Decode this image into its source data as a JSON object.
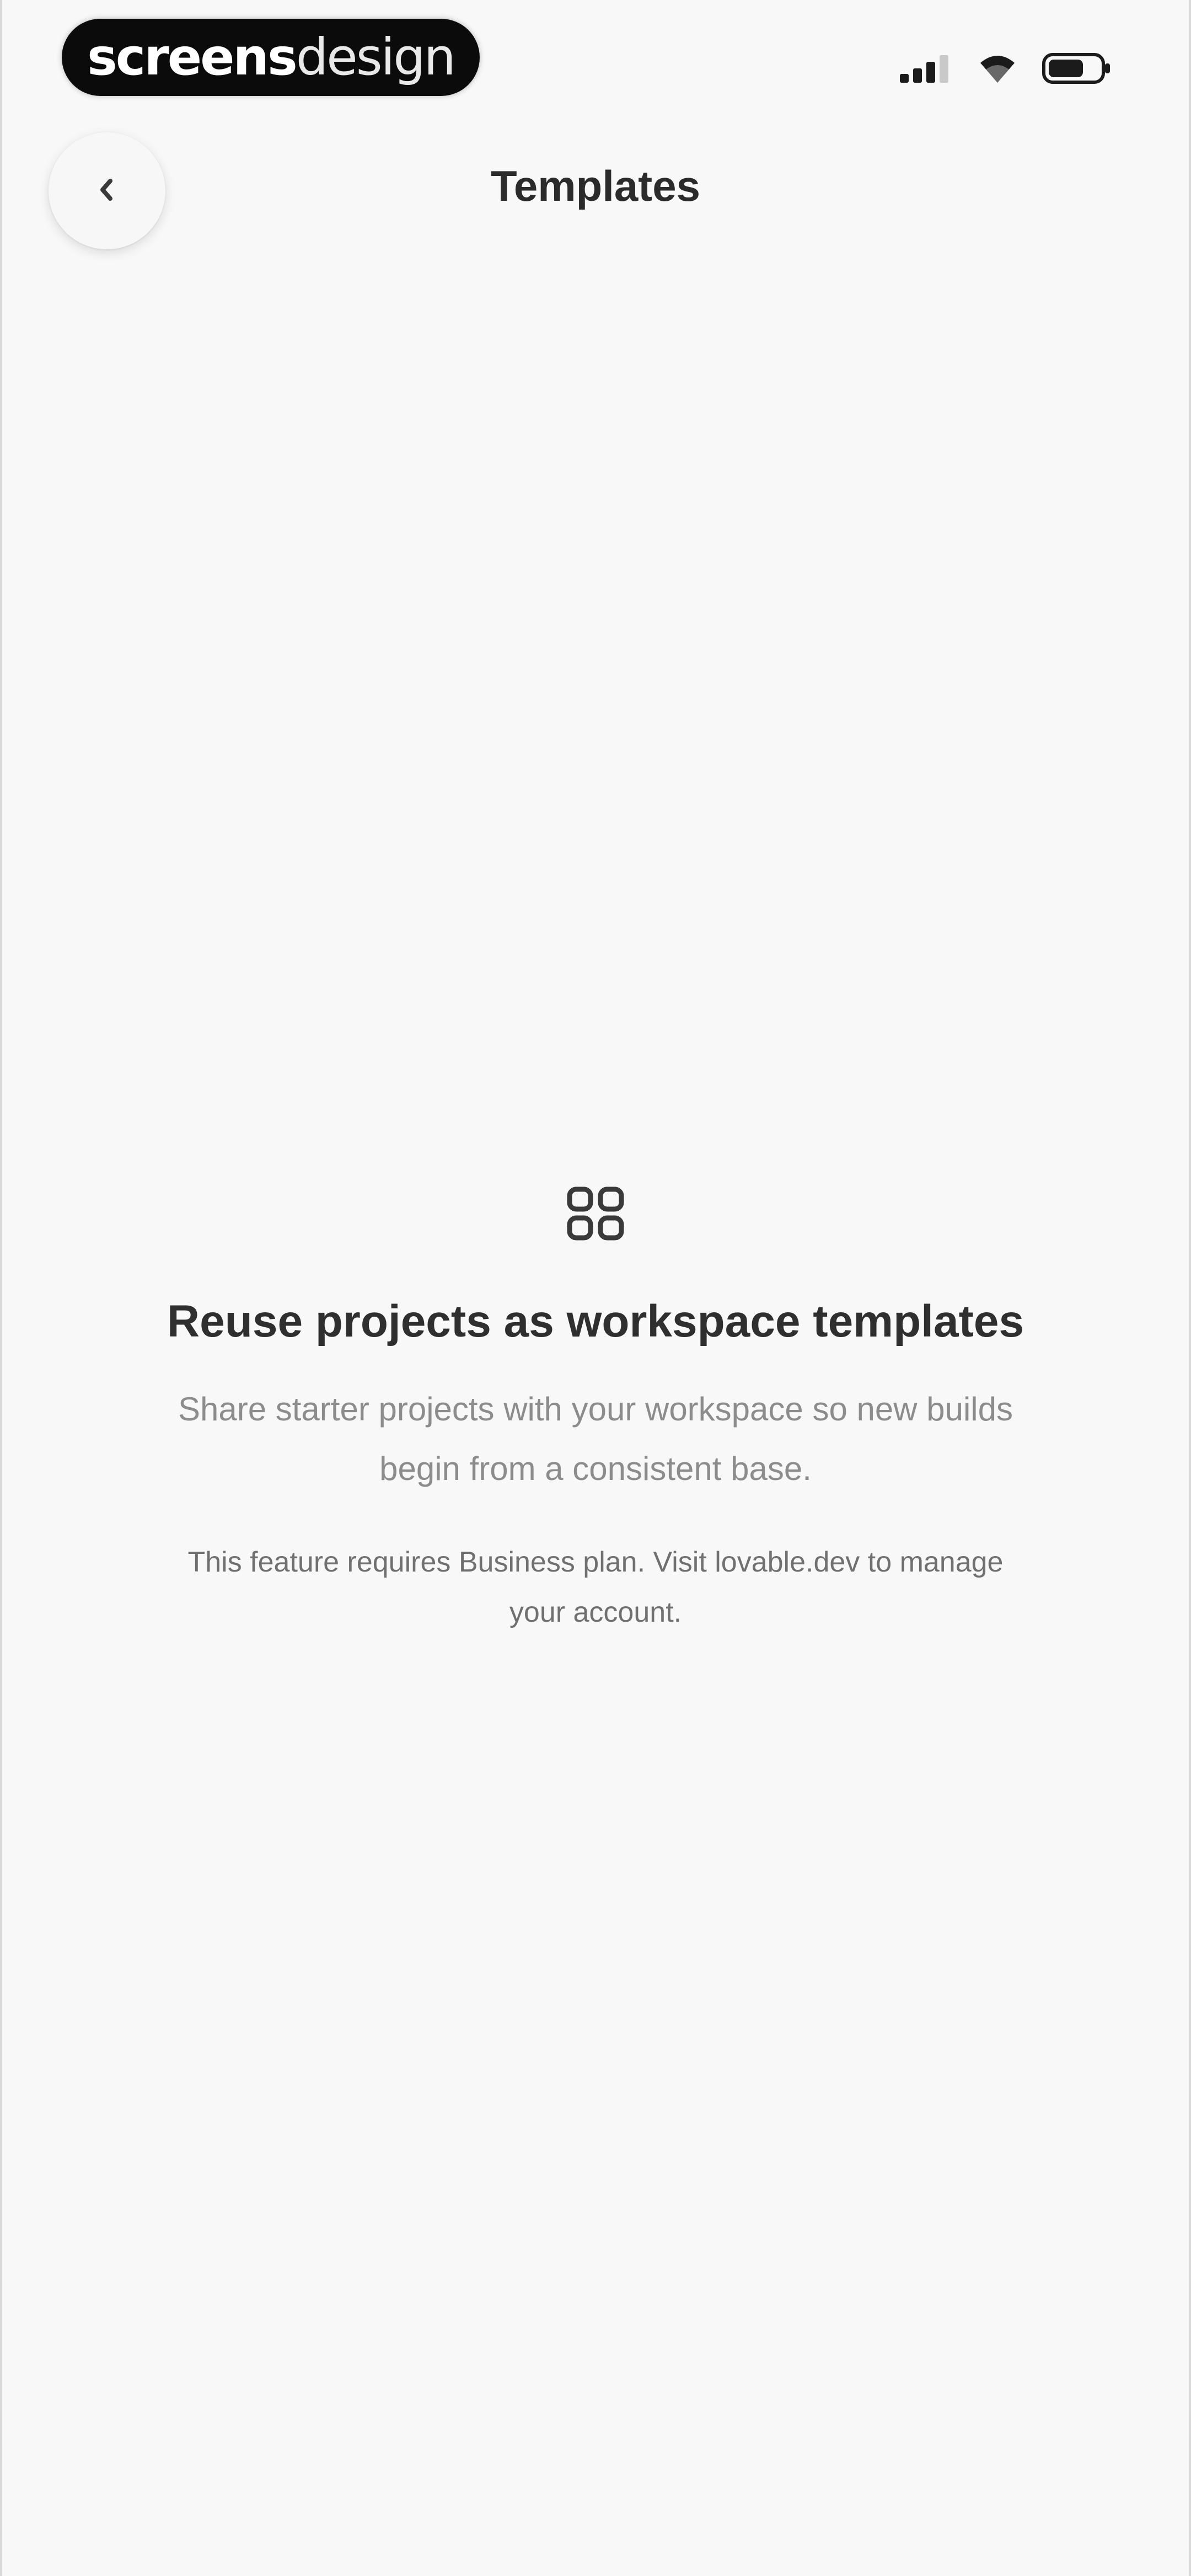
{
  "status_bar": {
    "brand": {
      "bold_part": "screens",
      "light_part": "design"
    },
    "icons": [
      "cellular-signal-icon",
      "wifi-icon",
      "battery-icon"
    ]
  },
  "header": {
    "back_icon": "chevron-left-icon",
    "title": "Templates"
  },
  "empty_state": {
    "icon": "templates-grid-icon",
    "title": "Reuse projects as workspace templates",
    "description": "Share starter projects with your workspace so new builds begin from a consistent base.",
    "plan_note": "This feature requires Business plan. Visit lovable.dev to manage your account."
  },
  "colors": {
    "background": "#f8f8f8",
    "title_text": "#2f2f2f",
    "muted_text": "#8c8c8c",
    "brand_pill": "#0b0b0b"
  }
}
